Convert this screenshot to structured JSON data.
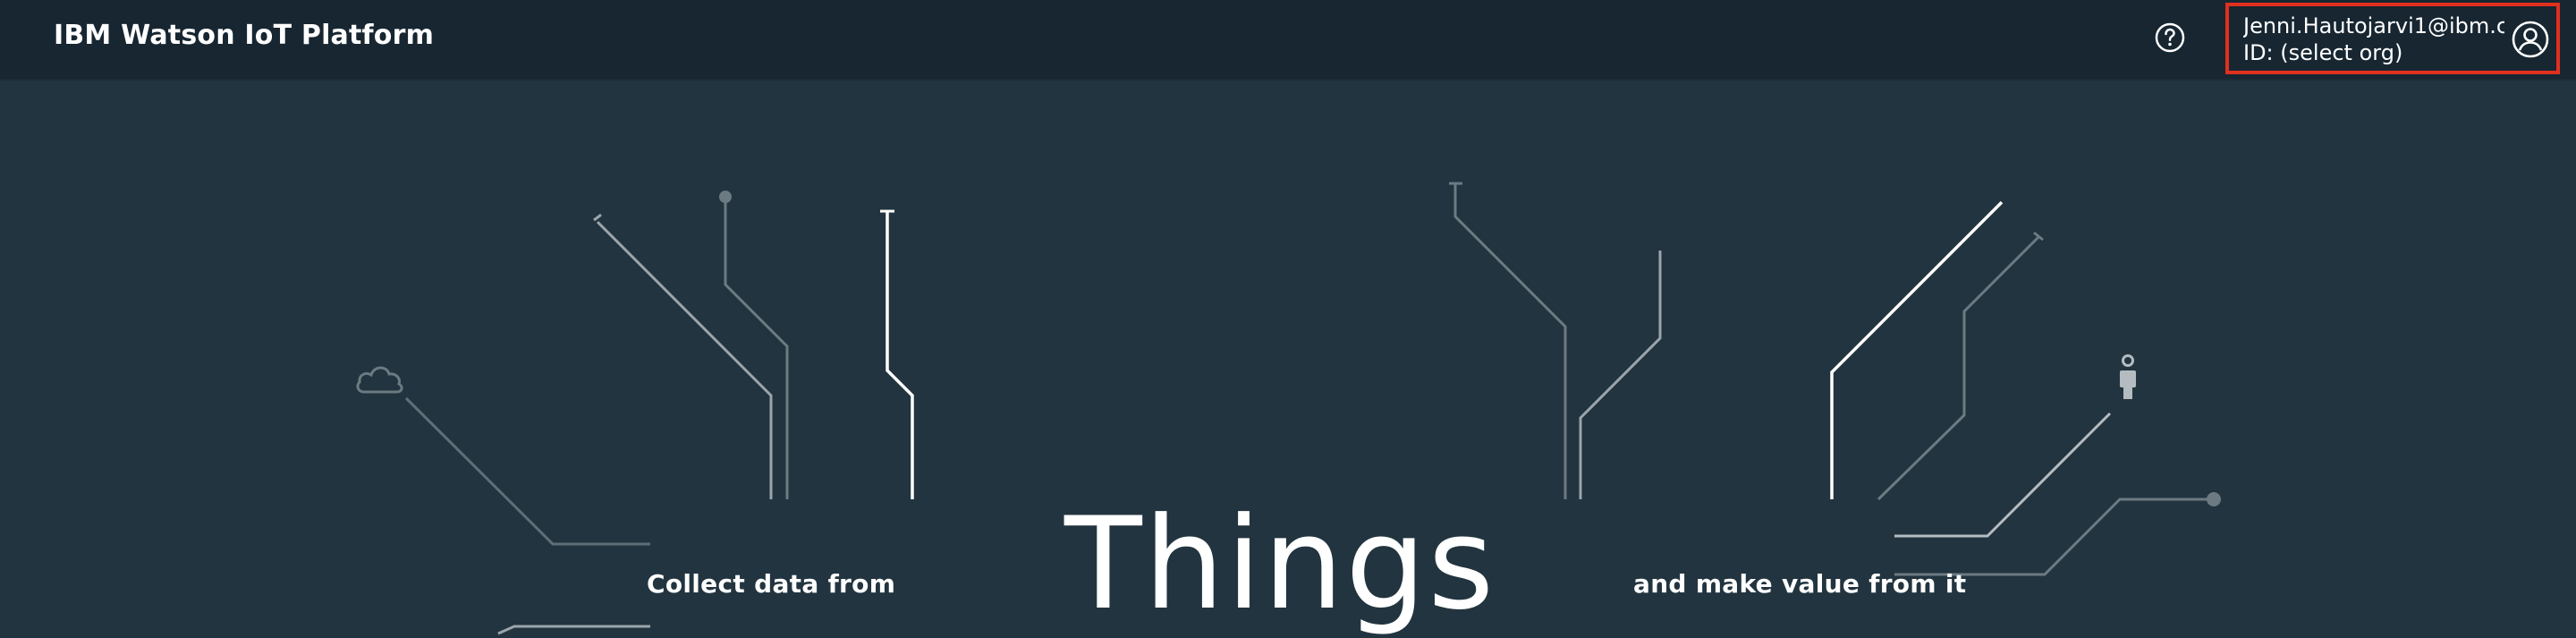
{
  "header": {
    "brand": "IBM Watson IoT Platform",
    "help_icon": "question-circle-icon",
    "account": {
      "user": "Jenni.Hautojarvi1@ibm.c...",
      "org": "ID: (select org)",
      "avatar_icon": "user-circle-icon",
      "highlight_color": "#e0301e"
    }
  },
  "hero": {
    "tagline_left": "Collect data from",
    "headline": "Things",
    "tagline_right": "and make value from it",
    "icons": [
      "cloud-icon",
      "person-icon"
    ]
  },
  "colors": {
    "background": "#22343f",
    "topbar": "#172631",
    "line_bright": "#ffffff",
    "line_mid": "#9ba5ab",
    "line_dim": "#5f6e77"
  }
}
